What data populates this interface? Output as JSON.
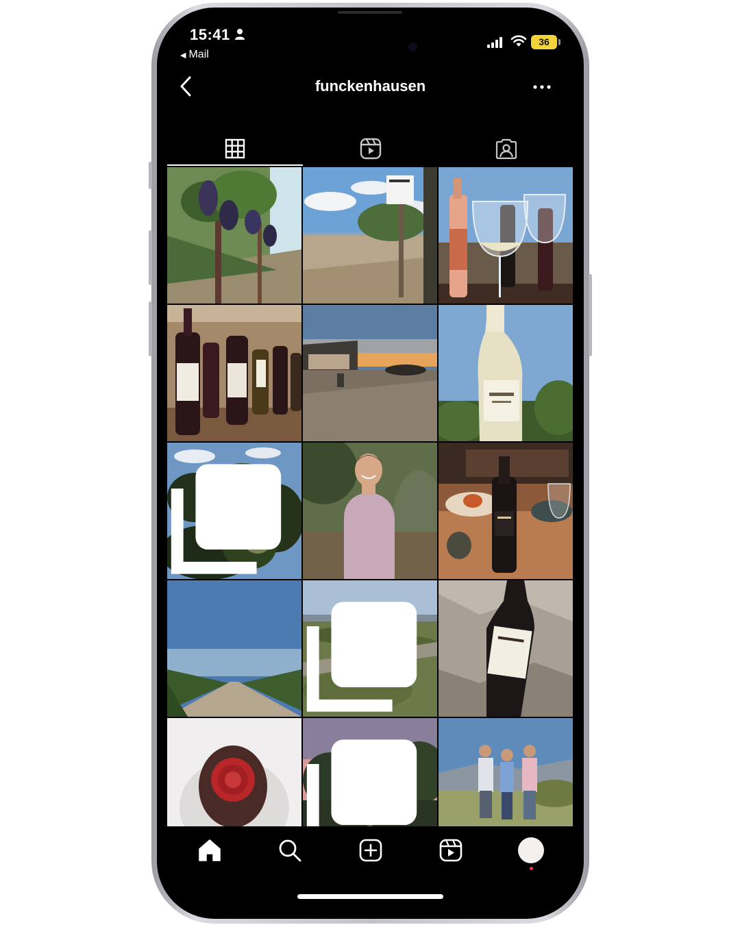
{
  "status_bar": {
    "time": "15:41",
    "back_app": "Mail",
    "battery": "36"
  },
  "header": {
    "username": "funckenhausen"
  },
  "tabs": [
    {
      "name": "posts-grid",
      "icon": "grid-icon",
      "selected": true
    },
    {
      "name": "reels",
      "icon": "reels-icon",
      "selected": false
    },
    {
      "name": "tagged",
      "icon": "tagged-person-icon",
      "selected": false
    }
  ],
  "posts": [
    {
      "subject": "grape-vine-clusters",
      "multi": false
    },
    {
      "subject": "vineyard-sign-landscape",
      "multi": false
    },
    {
      "subject": "wine-bottles-and-glasses",
      "multi": false
    },
    {
      "subject": "wine-bottles-on-shelf",
      "multi": false
    },
    {
      "subject": "winery-building-sunset",
      "multi": false
    },
    {
      "subject": "white-wine-bottle-la-espera",
      "multi": false
    },
    {
      "subject": "vine-leaves-sunlight",
      "multi": true
    },
    {
      "subject": "portrait-man-pink-shirt",
      "multi": false
    },
    {
      "subject": "red-wine-bottle-dinner",
      "multi": false
    },
    {
      "subject": "vineyard-road-blue-sky",
      "multi": false
    },
    {
      "subject": "river-valley-landscape",
      "multi": true
    },
    {
      "subject": "la-espera-bottle-on-rock",
      "multi": false
    },
    {
      "subject": "bottle-top-red-capsule",
      "multi": false
    },
    {
      "subject": "vineyard-pink-sunset",
      "multi": true
    },
    {
      "subject": "three-men-in-field",
      "multi": false
    }
  ],
  "bottom_nav": [
    {
      "name": "home",
      "icon": "home-icon",
      "selected": true
    },
    {
      "name": "search",
      "icon": "search-icon",
      "selected": false
    },
    {
      "name": "create",
      "icon": "plus-square-icon",
      "selected": false
    },
    {
      "name": "reels",
      "icon": "reels-icon",
      "selected": false
    },
    {
      "name": "profile",
      "icon": "avatar-icon",
      "selected": false
    }
  ],
  "colors": {
    "background": "#000000",
    "text": "#ffffff",
    "battery": "#f2d43a",
    "notification": "#ff3040"
  }
}
